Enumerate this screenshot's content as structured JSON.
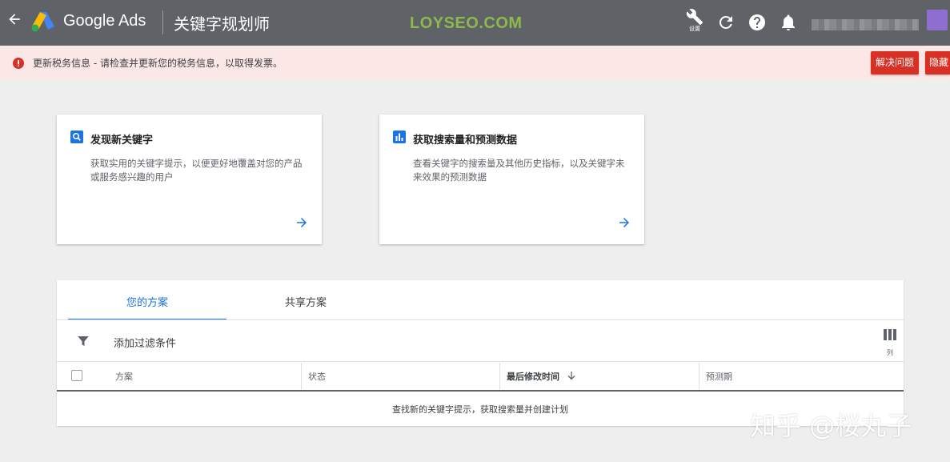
{
  "topbar": {
    "brand": "Google Ads",
    "page_title": "关键字规划师",
    "watermark": "LOYSEO.COM",
    "settings_label": "设置",
    "background": "#5f6368"
  },
  "alert": {
    "message": "更新税务信息 - 请检查并更新您的税务信息，以取得发票。",
    "fix_button": "解决问题",
    "hide_button": "隐藏",
    "accent": "#d93025"
  },
  "cards": [
    {
      "title": "发现新关键字",
      "description": "获取实用的关键字提示，以便更好地覆盖对您的产品或服务感兴趣的用户",
      "icon": "search-icon"
    },
    {
      "title": "获取搜索量和预测数据",
      "description": "查看关键字的搜索量及其他历史指标，以及关键字未来效果的预测数据",
      "icon": "bar-chart-icon"
    }
  ],
  "plans": {
    "tabs": [
      "您的方案",
      "共享方案"
    ],
    "filter_label": "添加过滤条件",
    "columns_label": "列",
    "table_headers": [
      "方案",
      "状态",
      "最后修改时间",
      "预测期"
    ],
    "empty_message": "查找新的关键字提示，获取搜索量并创建计划"
  },
  "footer_watermark": "知乎 @桜丸子",
  "colors": {
    "accent_blue": "#1a73e8",
    "page_background": "#eeeeee"
  }
}
